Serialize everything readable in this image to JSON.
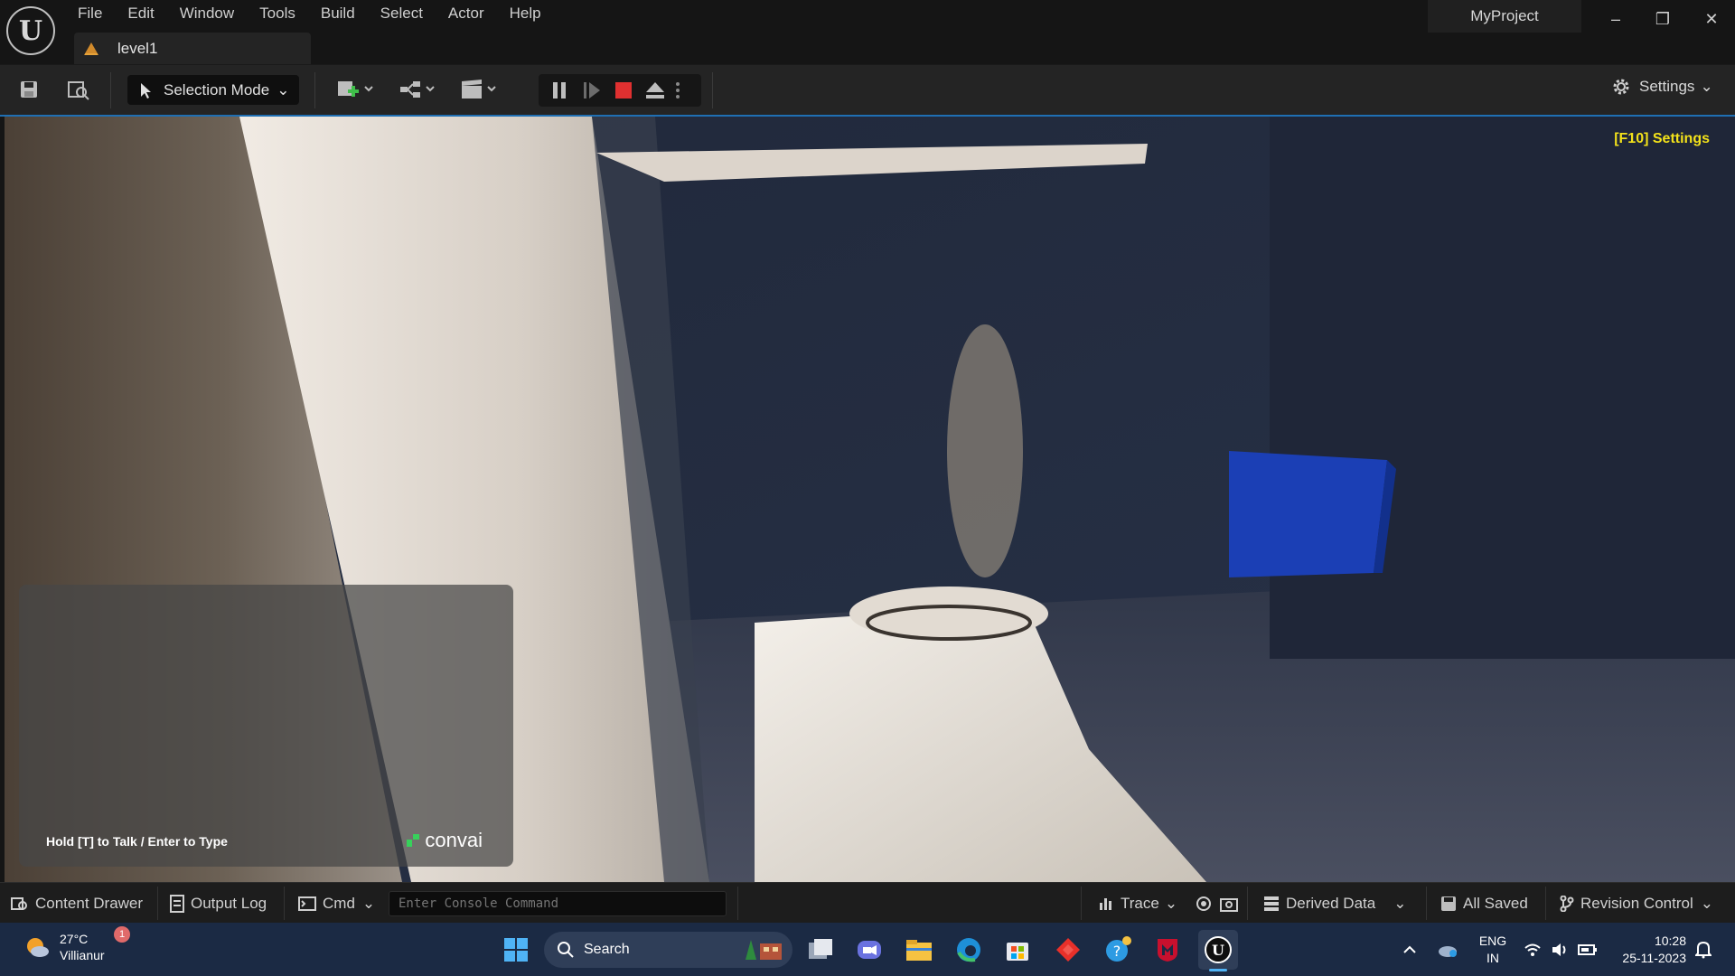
{
  "menu": [
    "File",
    "Edit",
    "Window",
    "Tools",
    "Build",
    "Select",
    "Actor",
    "Help"
  ],
  "tab": {
    "label": "level1"
  },
  "project": {
    "name": "MyProject"
  },
  "toolbar": {
    "selection_mode": "Selection Mode",
    "settings": "Settings"
  },
  "viewport": {
    "f10_settings": "[F10] Settings"
  },
  "chat": {
    "hint": "Hold [T] to Talk / Enter to Type",
    "brand": "convai"
  },
  "statusbar": {
    "content_drawer": "Content Drawer",
    "output_log": "Output Log",
    "cmd": "Cmd",
    "console_placeholder": "Enter Console Command",
    "trace": "Trace",
    "derived_data": "Derived Data",
    "all_saved": "All Saved",
    "revision_control": "Revision Control"
  },
  "taskbar": {
    "weather_temp": "27°C",
    "weather_location": "Villianur",
    "weather_badge": "1",
    "search": "Search",
    "lang": "ENG",
    "region": "IN",
    "time": "10:28",
    "date": "25-11-2023"
  },
  "colors": {
    "accent": "#1f6fb3",
    "f10_yellow": "#f3e21a",
    "stop_red": "#e03030",
    "taskbar": "#1b2a44"
  }
}
